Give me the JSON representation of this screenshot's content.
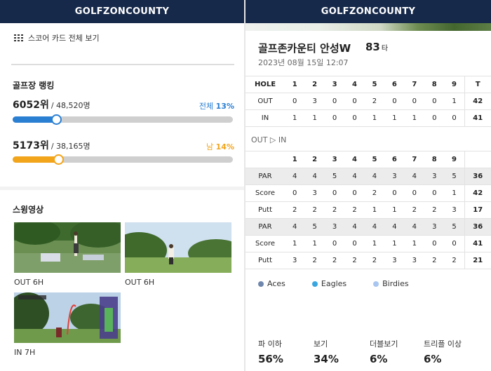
{
  "left": {
    "brand": "GOLFZONCOUNTY",
    "scorecard_link": "스코어 카드 전체 보기",
    "ranking": {
      "title": "골프장 랭킹",
      "overall": {
        "rank": "6052위",
        "total": "/ 48,520명",
        "label": "전체",
        "pct": "13%",
        "fill_fraction": 0.13,
        "color": "#2a7fd3"
      },
      "gender": {
        "rank": "5173위",
        "total": "/ 38,165명",
        "label": "남",
        "pct": "14%",
        "fill_fraction": 0.14,
        "color": "#f2a51a"
      }
    },
    "swing": {
      "title": "스윙영상",
      "videos": [
        {
          "caption": "OUT 6H"
        },
        {
          "caption": "OUT 6H"
        },
        {
          "caption": "IN 7H"
        }
      ]
    }
  },
  "right": {
    "brand": "GOLFZONCOUNTY",
    "course_name": "골프존카운티 안성W",
    "total_score": "83",
    "score_unit": "타",
    "play_date": "2023년 08월 15일 12:07",
    "summary": {
      "header": [
        "HOLE",
        "1",
        "2",
        "3",
        "4",
        "5",
        "6",
        "7",
        "8",
        "9",
        "T"
      ],
      "rows": [
        [
          "OUT",
          "0",
          "3",
          "0",
          "0",
          "2",
          "0",
          "0",
          "0",
          "1",
          "42"
        ],
        [
          "IN",
          "1",
          "1",
          "0",
          "0",
          "1",
          "1",
          "1",
          "0",
          "0",
          "41"
        ]
      ]
    },
    "out_in_label": "OUT ▷ IN",
    "detail": {
      "header": [
        "",
        "1",
        "2",
        "3",
        "4",
        "5",
        "6",
        "7",
        "8",
        "9",
        ""
      ],
      "rows": [
        [
          "PAR",
          "4",
          "4",
          "5",
          "4",
          "4",
          "3",
          "4",
          "3",
          "5",
          "36"
        ],
        [
          "Score",
          "0",
          "3",
          "0",
          "0",
          "2",
          "0",
          "0",
          "0",
          "1",
          "42"
        ],
        [
          "Putt",
          "2",
          "2",
          "2",
          "2",
          "1",
          "1",
          "2",
          "2",
          "3",
          "17"
        ],
        [
          "PAR",
          "4",
          "5",
          "3",
          "4",
          "4",
          "4",
          "4",
          "3",
          "5",
          "36"
        ],
        [
          "Score",
          "1",
          "1",
          "0",
          "0",
          "1",
          "1",
          "1",
          "0",
          "0",
          "41"
        ],
        [
          "Putt",
          "3",
          "2",
          "2",
          "2",
          "2",
          "3",
          "3",
          "2",
          "2",
          "21"
        ]
      ]
    },
    "legend": [
      {
        "label": "Aces",
        "color": "#6f86ad"
      },
      {
        "label": "Eagles",
        "color": "#3aa6e0"
      },
      {
        "label": "Birdies",
        "color": "#a8c6f0"
      }
    ],
    "stats": [
      {
        "label": "파 이하",
        "value": "56%"
      },
      {
        "label": "보기",
        "value": "34%"
      },
      {
        "label": "더블보기",
        "value": "6%"
      },
      {
        "label": "트리플 이상",
        "value": "6%"
      }
    ]
  }
}
